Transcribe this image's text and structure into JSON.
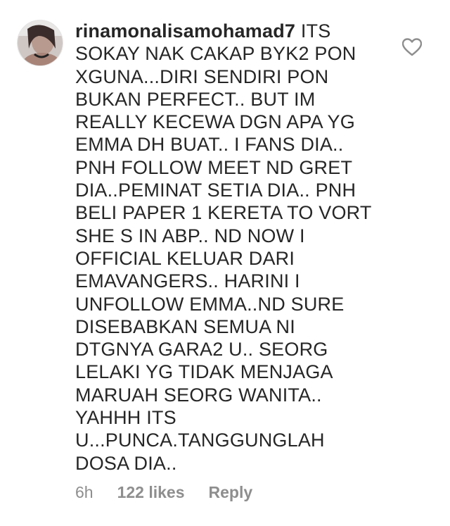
{
  "comment": {
    "username": "rinamonalisamohamad7",
    "text": "ITS SOKAY NAK CAKAP BYK2 PON XGUNA...DIRI SENDIRI PON BUKAN PERFECT.. BUT IM REALLY KECEWA DGN APA YG EMMA DH BUAT.. I FANS DIA.. PNH FOLLOW MEET ND GRET DIA..PEMINAT SETIA DIA.. PNH BELI PAPER 1 KERETA TO VORT SHE S IN ABP.. ND NOW I OFFICIAL KELUAR DARI EMAVANGERS.. HARINI I UNFOLLOW EMMA..ND SURE DISEBABKAN SEMUA NI DTGNYA GARA2  U.. SEORG LELAKI YG TIDAK MENJAGA MARUAH SEORG WANITA.. YAHHH ITS U...PUNCA.TANGGUNGLAH DOSA DIA..",
    "time": "6h",
    "likes": "122 likes",
    "reply_label": "Reply"
  },
  "icons": {
    "like": "heart-outline-icon",
    "avatar": "profile-photo"
  },
  "colors": {
    "text": "#262626",
    "meta": "#8e8e8e",
    "icon": "#8e8e8e"
  }
}
